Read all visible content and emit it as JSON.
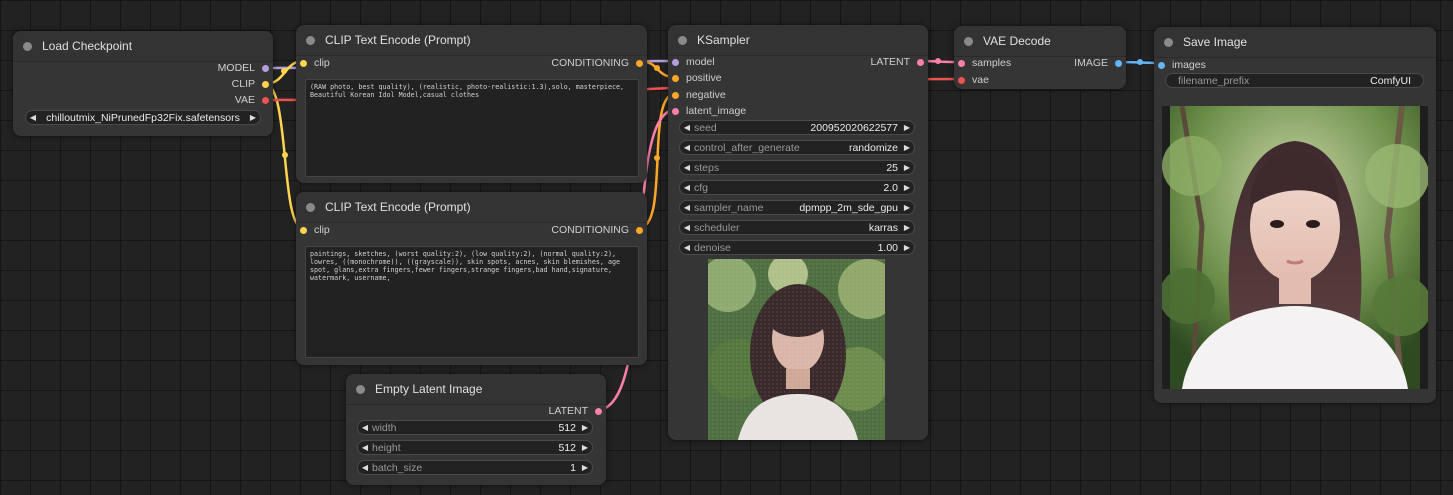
{
  "colors": {
    "model": "#b39ddb",
    "clip": "#ffd54f",
    "vae": "#ef5350",
    "conditioning": "#ffa726",
    "latent": "#ff80ab",
    "image": "#64b5f6",
    "canvas": "#222222",
    "node_body": "#353535"
  },
  "load_checkpoint": {
    "title": "Load Checkpoint",
    "outputs": [
      "MODEL",
      "CLIP",
      "VAE"
    ],
    "ckpt_name": "chilloutmix_NiPrunedFp32Fix.safetensors"
  },
  "clip_positive": {
    "title": "CLIP Text Encode (Prompt)",
    "input": "clip",
    "output": "CONDITIONING",
    "text": "(RAW photo, best quality), (realistic, photo-realistic:1.3),solo, masterpiece, Beautiful Korean Idol Model,casual clothes"
  },
  "clip_negative": {
    "title": "CLIP Text Encode (Prompt)",
    "input": "clip",
    "output": "CONDITIONING",
    "text": "paintings, sketches, (worst quality:2), (low quality:2), (normal quality:2), lowres, ((monochrome)), ((grayscale)), skin spots, acnes, skin blemishes, age spot, glans,extra fingers,fewer fingers,strange fingers,bad hand,signature, watermark, username,"
  },
  "empty_latent": {
    "title": "Empty Latent Image",
    "output": "LATENT",
    "widgets": [
      {
        "label": "width",
        "value": "512"
      },
      {
        "label": "height",
        "value": "512"
      },
      {
        "label": "batch_size",
        "value": "1"
      }
    ]
  },
  "ksampler": {
    "title": "KSampler",
    "inputs": [
      "model",
      "positive",
      "negative",
      "latent_image"
    ],
    "output": "LATENT",
    "widgets": [
      {
        "label": "seed",
        "value": "200952020622577"
      },
      {
        "label": "control_after_generate",
        "value": "randomize"
      },
      {
        "label": "steps",
        "value": "25"
      },
      {
        "label": "cfg",
        "value": "2.0"
      },
      {
        "label": "sampler_name",
        "value": "dpmpp_2m_sde_gpu"
      },
      {
        "label": "scheduler",
        "value": "karras"
      },
      {
        "label": "denoise",
        "value": "1.00"
      }
    ]
  },
  "vae_decode": {
    "title": "VAE Decode",
    "inputs": [
      "samples",
      "vae"
    ],
    "output": "IMAGE"
  },
  "save_image": {
    "title": "Save Image",
    "input": "images",
    "filename_prefix_label": "filename_prefix",
    "filename_prefix_value": "ComfyUI"
  }
}
